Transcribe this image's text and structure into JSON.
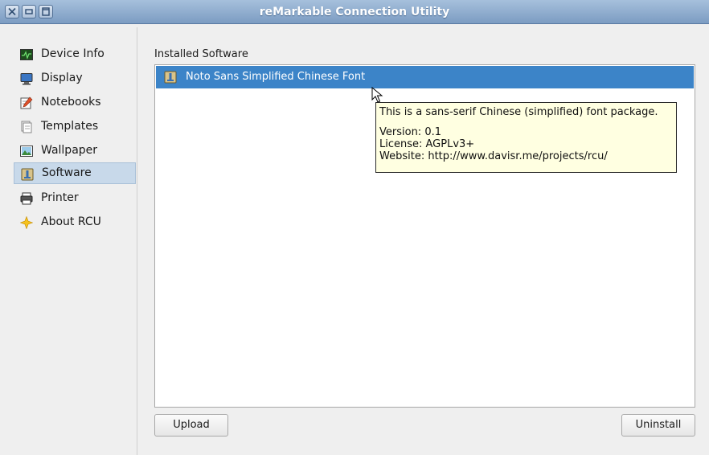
{
  "window": {
    "title": "reMarkable Connection Utility"
  },
  "titlebar_buttons": [
    {
      "name": "close-icon"
    },
    {
      "name": "minimize-icon"
    },
    {
      "name": "maximize-icon"
    }
  ],
  "sidebar": {
    "items": [
      {
        "label": "Device Info",
        "icon": "device-info-icon"
      },
      {
        "label": "Display",
        "icon": "display-icon"
      },
      {
        "label": "Notebooks",
        "icon": "notebooks-icon"
      },
      {
        "label": "Templates",
        "icon": "templates-icon"
      },
      {
        "label": "Wallpaper",
        "icon": "wallpaper-icon"
      },
      {
        "label": "Software",
        "icon": "software-icon",
        "selected": true
      },
      {
        "label": "Printer",
        "icon": "printer-icon"
      },
      {
        "label": "About RCU",
        "icon": "about-star-icon"
      }
    ]
  },
  "main": {
    "section_label": "Installed Software",
    "packages": [
      {
        "name": "Noto Sans Simplified Chinese Font",
        "selected": true
      }
    ],
    "upload_label": "Upload",
    "uninstall_label": "Uninstall"
  },
  "tooltip": {
    "description": "This is a sans-serif Chinese (simplified) font package.",
    "version": "Version: 0.1",
    "license": "License: AGPLv3+",
    "website": "Website: http://www.davisr.me/projects/rcu/"
  },
  "colors": {
    "titlebar": "#7c9cc2",
    "selection": "#3c84c8",
    "sidebar_selection": "#c8d9ea",
    "tooltip_bg": "#ffffe1"
  }
}
